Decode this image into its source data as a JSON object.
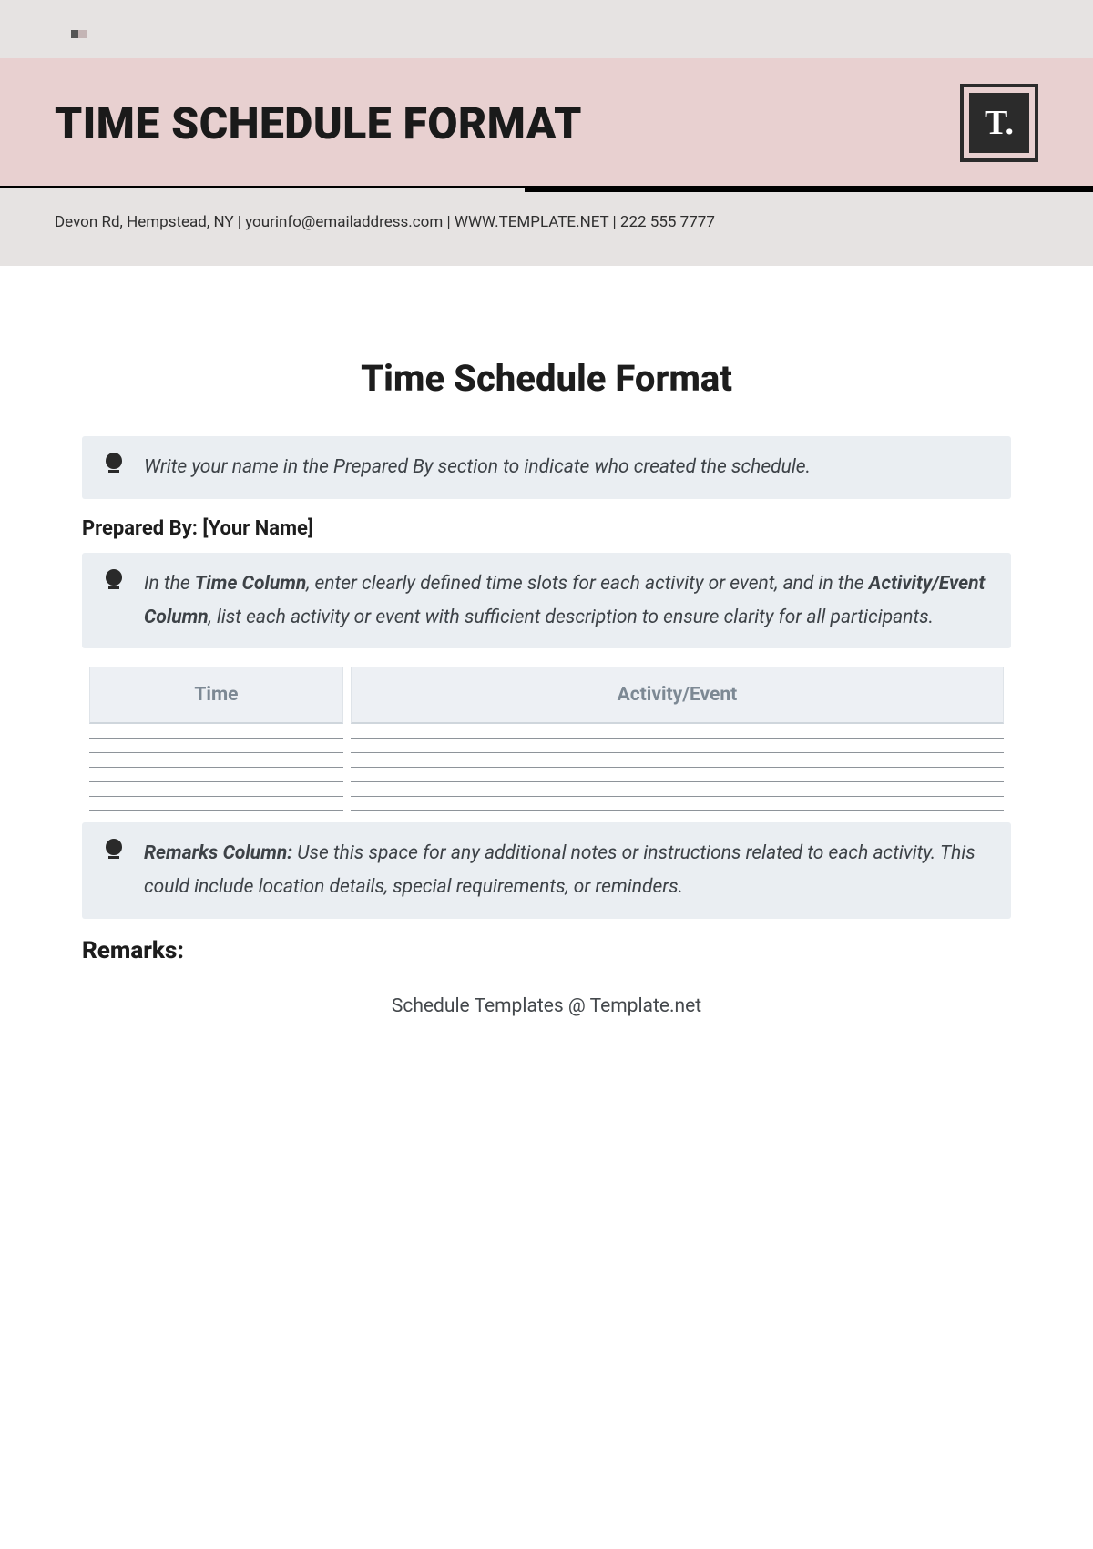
{
  "banner": {
    "title": "TIME SCHEDULE FORMAT",
    "logo_text": "T."
  },
  "contact": "Devon Rd, Hempstead, NY | yourinfo@emailaddress.com | WWW.TEMPLATE.NET | 222 555 7777",
  "doc": {
    "title": "Time Schedule Format",
    "tip1": "Write your name in the Prepared By section to indicate who created the schedule.",
    "prepared_by": "Prepared By: [Your Name]",
    "tip2_pre": "In the ",
    "tip2_b1": "Time Column",
    "tip2_mid": ", enter clearly defined time slots for each activity or event, and in the ",
    "tip2_b2": "Activity/Event Column",
    "tip2_post": ", list each activity or event with sufficient description to ensure clarity for all participants.",
    "table": {
      "col_time": "Time",
      "col_activity": "Activity/Event"
    },
    "tip3_b": "Remarks Column:",
    "tip3_rest": " Use this space for any additional notes or instructions related to each activity. This could include location details, special requirements, or reminders.",
    "remarks_label": "Remarks:",
    "footer": "Schedule Templates @ Template.net"
  }
}
